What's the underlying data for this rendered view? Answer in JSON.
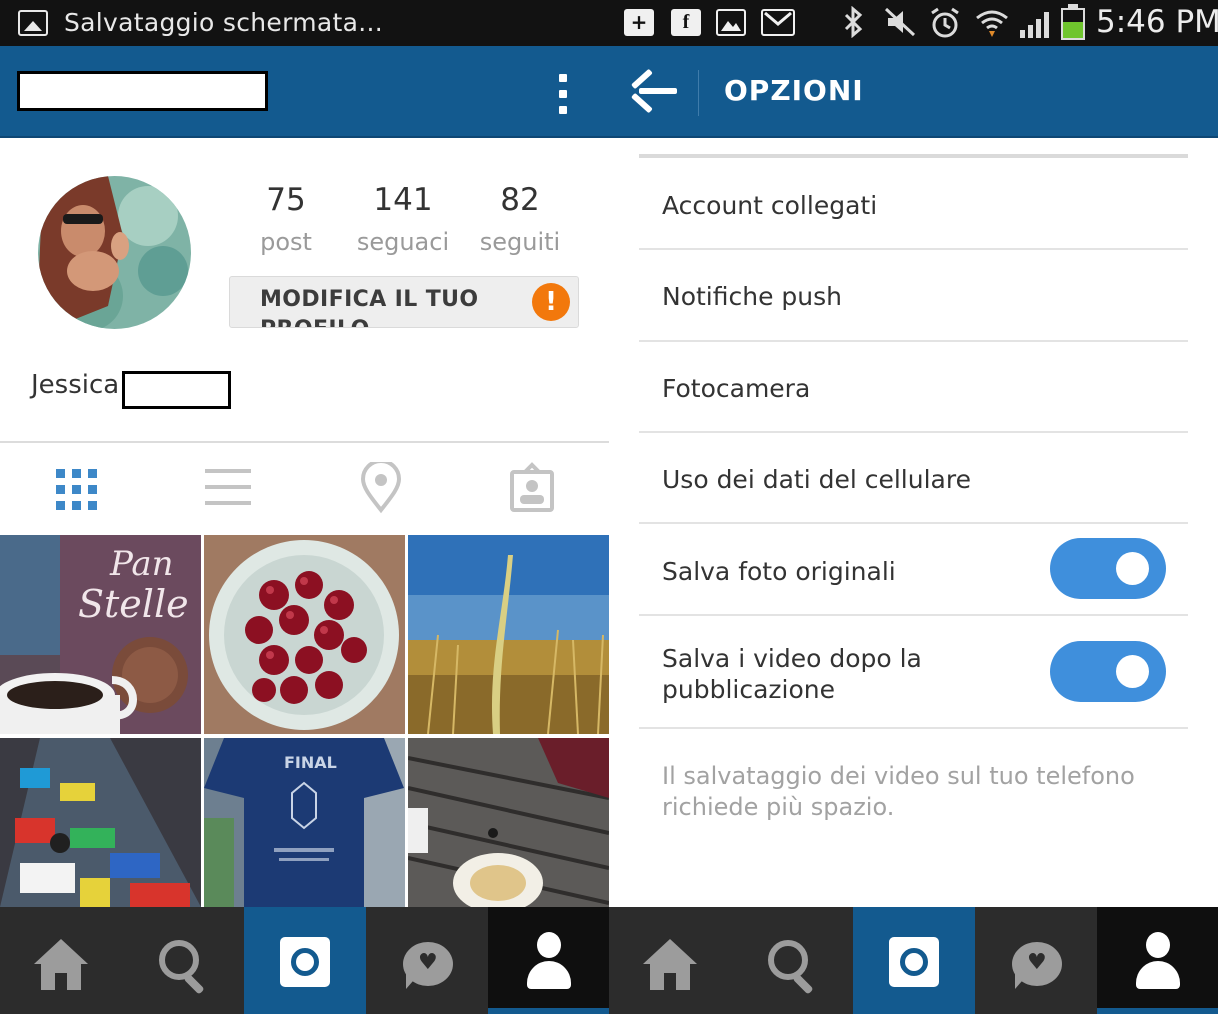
{
  "status_bar": {
    "notification_title": "Salvataggio schermata...",
    "time": "5:46 PM",
    "notification_icons": [
      "plus-icon",
      "facebook-icon",
      "image-icon",
      "mail-icon"
    ],
    "system_icons": [
      "bluetooth-icon",
      "mute-icon",
      "alarm-icon",
      "wifi-icon",
      "signal-icon",
      "battery-icon"
    ]
  },
  "profile": {
    "stats": [
      {
        "value": "75",
        "label": "post"
      },
      {
        "value": "141",
        "label": "seguaci"
      },
      {
        "value": "82",
        "label": "seguiti"
      }
    ],
    "edit_button": "MODIFICA IL TUO PROFILO",
    "edit_alert": "!",
    "first_name": "Jessica",
    "tabs": [
      "grid-icon",
      "list-icon",
      "location-icon",
      "tagged-icon"
    ],
    "photos": [
      "cookies-and-coffee",
      "bowl-of-cherries",
      "wheat-field",
      "graffiti-floor",
      "juventus-final-shirt",
      "wooden-table-plate"
    ]
  },
  "options": {
    "title": "OPZIONI",
    "items": [
      "Account collegati",
      "Notifiche push",
      "Fotocamera",
      "Uso dei dati del cellulare"
    ],
    "toggles": [
      {
        "label": "Salva foto originali",
        "on": true
      },
      {
        "label": "Salva i video dopo la pubblicazione",
        "on": true
      }
    ],
    "note": "Il salvataggio dei video sul tuo telefono richiede più spazio."
  },
  "bottom_nav": {
    "items": [
      "home-icon",
      "search-icon",
      "camera-icon",
      "activity-icon",
      "profile-icon"
    ],
    "active": "profile-icon"
  },
  "colors": {
    "header_blue": "#135a8f",
    "toggle_blue": "#3f8fdc",
    "alert_orange": "#f2780c",
    "nav_dark": "#2c2c2c"
  }
}
